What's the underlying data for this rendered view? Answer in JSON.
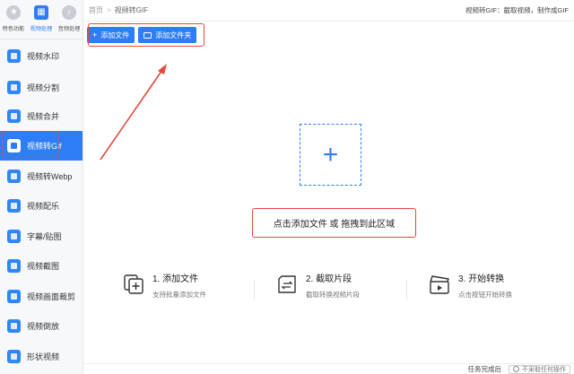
{
  "categories": [
    {
      "label": "特色功能",
      "icon": "star-icon",
      "active": false
    },
    {
      "label": "视频处理",
      "icon": "film-icon",
      "active": true
    },
    {
      "label": "音频处理",
      "icon": "music-icon",
      "active": false
    }
  ],
  "nav": [
    {
      "label": "视频水印",
      "icon": "stamp-icon"
    },
    {
      "label": "视频分割",
      "icon": "split-icon"
    },
    {
      "label": "视频合并",
      "icon": "merge-icon"
    },
    {
      "label": "视频转Gif",
      "icon": "gif-icon",
      "active": true
    },
    {
      "label": "视频转Webp",
      "icon": "webp-icon"
    },
    {
      "label": "视频配乐",
      "icon": "music-note-icon"
    },
    {
      "label": "字幕/贴图",
      "icon": "sticker-icon"
    },
    {
      "label": "视频截图",
      "icon": "screenshot-icon"
    },
    {
      "label": "视频画面裁剪",
      "icon": "crop-icon"
    },
    {
      "label": "视频倒放",
      "icon": "reverse-icon"
    },
    {
      "label": "形状视频",
      "icon": "shape-icon"
    }
  ],
  "breadcrumb": {
    "home": "首页",
    "separator": ">",
    "current": "视频转GIF"
  },
  "tip": "视频转GIF：截取视频，制作成GIF",
  "toolbar": {
    "add_file": "添加文件",
    "add_folder": "添加文件夹",
    "add_file_icon": "+"
  },
  "drop_zone": {
    "plus": "+",
    "text": "点击添加文件 或 拖拽到此区域"
  },
  "steps": [
    {
      "title": "1. 添加文件",
      "desc": "支持批量添加文件",
      "icon": "add-file-icon"
    },
    {
      "title": "2. 截取片段",
      "desc": "截取转换视频片段",
      "icon": "cut-icon"
    },
    {
      "title": "3. 开始转换",
      "desc": "点击按钮开始转换",
      "icon": "clapper-icon"
    }
  ],
  "status": {
    "label": "任务完成后",
    "option": "不采取任何操作"
  },
  "colors": {
    "accent": "#2e7df6",
    "highlight": "#e5483d"
  }
}
